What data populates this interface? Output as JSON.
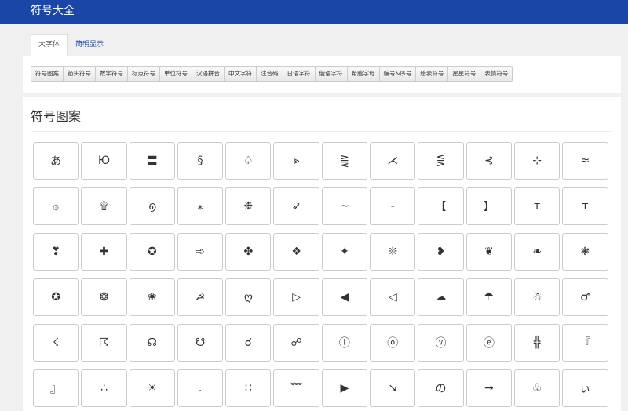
{
  "app": {
    "title": "符号大全"
  },
  "tabs": [
    {
      "label": "大字体",
      "active": true
    },
    {
      "label": "简明显示",
      "active": false
    }
  ],
  "categories": [
    "符号图案",
    "箭头符号",
    "数学符号",
    "标点符号",
    "单位符号",
    "汉语拼音",
    "中文字符",
    "注音码",
    "日语字符",
    "俄语字符",
    "希腊字母",
    "编号&序号",
    "绘表符号",
    "星星符号",
    "表情符号"
  ],
  "section": {
    "title": "符号图案"
  },
  "symbols": [
    "あ",
    "Ю",
    "〓",
    "§",
    "♤",
    "⪢",
    "⪌",
    "⋌",
    "⋚",
    "⊰",
    "⊹",
    "≈",
    "۞",
    "۩",
    "൭",
    "⁎",
    "❉",
    "➶",
    "~",
    "-",
    "【",
    "】",
    "ᴛ",
    "ᴛ",
    "❣",
    "✚",
    "✪",
    "➾",
    "✤",
    "❖",
    "✦",
    "❊",
    "❥",
    "❦",
    "❧",
    "❃",
    "✪",
    "❂",
    "❀",
    "☭",
    "ღ",
    "▷",
    "◀",
    "◁",
    "☁",
    "☂",
    "☃",
    "♂",
    "☇",
    "☈",
    "☊",
    "☋",
    "☌",
    "☍",
    "ⓛ",
    "ⓞ",
    "ⓥ",
    "ⓔ",
    "╬",
    "『",
    "』",
    "∴",
    "☀",
    "․",
    "∷",
    "﹌",
    "▶",
    "↘",
    "の",
    "→",
    "♧",
    "ぃ"
  ]
}
